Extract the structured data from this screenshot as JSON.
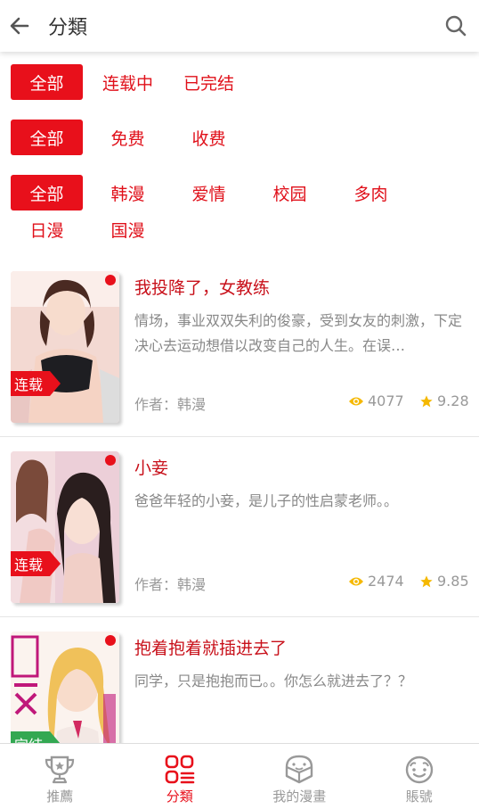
{
  "header": {
    "title": "分類",
    "back_icon": "arrow-left-icon",
    "search_icon": "search-icon"
  },
  "filters": {
    "status": [
      {
        "label": "全部",
        "active": true
      },
      {
        "label": "连载中",
        "active": false
      },
      {
        "label": "已完结",
        "active": false
      }
    ],
    "price": [
      {
        "label": "全部",
        "active": true
      },
      {
        "label": "免费",
        "active": false
      },
      {
        "label": "收费",
        "active": false
      }
    ],
    "genre": [
      {
        "label": "全部",
        "active": true
      },
      {
        "label": "韩漫",
        "active": false
      },
      {
        "label": "爱情",
        "active": false
      },
      {
        "label": "校园",
        "active": false
      },
      {
        "label": "多肉",
        "active": false
      },
      {
        "label": "日漫",
        "active": false
      },
      {
        "label": "国漫",
        "active": false
      }
    ]
  },
  "comics": [
    {
      "title": "我投降了，女教练",
      "desc": "情场，事业双双失利的俊豪，受到女友的刺激，下定决心去运动想借以改变自己的人生。在误…",
      "tag": "连载",
      "author": "作者：韩漫",
      "views": "4077",
      "rating": "9.28"
    },
    {
      "title": "小妾",
      "desc": "爸爸年轻的小妾，是儿子的性启蒙老师。。",
      "tag": "连载",
      "author": "作者：韩漫",
      "views": "2474",
      "rating": "9.85"
    },
    {
      "title": "抱着抱着就插进去了",
      "desc": "同学，只是抱抱而已。。你怎么就进去了？？",
      "tag": "完结",
      "author": "",
      "views": "",
      "rating": ""
    }
  ],
  "tabbar": [
    {
      "label": "推薦",
      "icon": "trophy-icon",
      "active": false
    },
    {
      "label": "分類",
      "icon": "category-grid-icon",
      "active": true
    },
    {
      "label": "我的漫畫",
      "icon": "book-face-icon",
      "active": false
    },
    {
      "label": "賬號",
      "icon": "smiley-face-icon",
      "active": false
    }
  ],
  "colors": {
    "accent": "#e8101b",
    "title_red": "#c8101a",
    "complete_green": "#33a852",
    "star": "#f5b800"
  }
}
